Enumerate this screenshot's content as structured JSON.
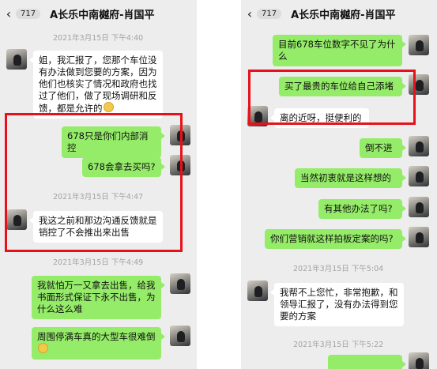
{
  "chat": {
    "title": "A长乐中南樾府-肖国平",
    "unread": "717",
    "back_icon": "chevron-left-icon"
  },
  "left": {
    "ts1": "2021年3月15日 下午4:40",
    "m1": "姐，我汇报了，您那个车位没有办法做到您要的方案，因为他们也核实了情况和政府也找过了他们，做了现场调研和反馈，都是允许的",
    "m2": "678只是你们内部消控",
    "m3": "678会拿去买吗?",
    "ts2": "2021年3月15日 下午4:47",
    "m4": "我这之前和那边沟通反馈就是销控了不会推出来出售",
    "ts3": "2021年3月15日 下午4:49",
    "m5": "我就怕万一又拿去出售，给我书面形式保证下永不出售，为什么这么难",
    "m6": "周围停满车真的大型车很难倒"
  },
  "right": {
    "m1": "目前678车位数字不见了为什么",
    "m2": "买了最贵的车位给自己添堵",
    "m3": "离的近呀，挺便利的",
    "m4": "倒不进",
    "m5": "当然初衷就是这样想的",
    "m6": "有其他办法了吗?",
    "m7": "你们营销就这样拍板定案的吗?",
    "ts1": "2021年3月15日 下午5:04",
    "m8": "我帮不上您忙，非常抱歉，和领导汇报了，没有办法得到您要的方案",
    "ts2": "2021年3月15日 下午5:22"
  },
  "colors": {
    "background": "#ededed",
    "bubble_me": "#95ec69",
    "bubble_other": "#ffffff",
    "highlight_box": "#e8111b"
  }
}
